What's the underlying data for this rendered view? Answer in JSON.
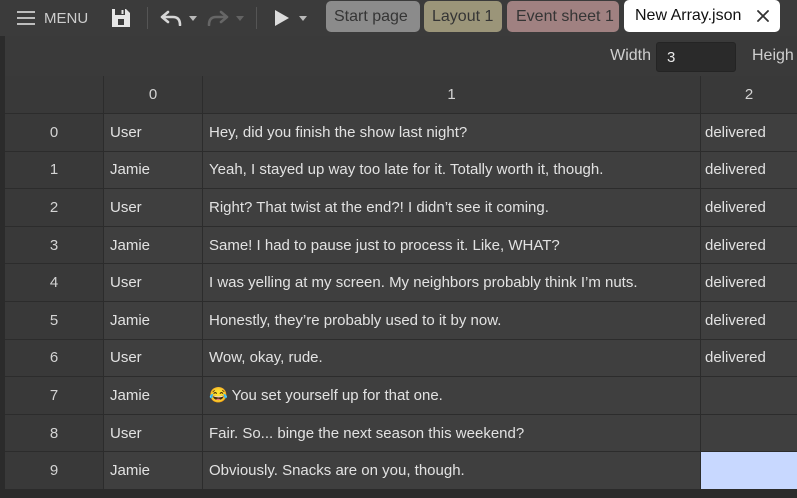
{
  "app": {
    "menu_label": "MENU",
    "icons": {
      "menu": "hamburger-icon",
      "save": "floppy-disk-icon",
      "undo": "undo-icon",
      "redo": "redo-icon",
      "play": "play-icon",
      "dropdown": "chevron-down-icon",
      "close": "close-icon"
    },
    "redo_enabled": false
  },
  "tabs": [
    {
      "label": "Start page",
      "color": "#8b8b8b",
      "active": false
    },
    {
      "label": "Layout 1",
      "color": "#9b9579",
      "active": false
    },
    {
      "label": "Event sheet 1",
      "color": "#a08181",
      "active": false
    },
    {
      "label": "New Array.json",
      "color": "#ffffff",
      "active": true
    }
  ],
  "toolbar": {
    "width_label": "Width",
    "width_value": "3",
    "height_label": "Heigh"
  },
  "array": {
    "column_headers": [
      "0",
      "1",
      "2"
    ],
    "rows": [
      {
        "index": "0",
        "cells": [
          "User",
          "Hey, did you finish the show last night?",
          "delivered"
        ]
      },
      {
        "index": "1",
        "cells": [
          "Jamie",
          "Yeah, I stayed up way too late for it. Totally worth it, though.",
          "delivered"
        ]
      },
      {
        "index": "2",
        "cells": [
          "User",
          "Right? That twist at the end?! I didn’t see it coming.",
          "delivered"
        ]
      },
      {
        "index": "3",
        "cells": [
          "Jamie",
          "Same! I had to pause just to process it. Like, WHAT?",
          "delivered"
        ]
      },
      {
        "index": "4",
        "cells": [
          "User",
          "I was yelling at my screen. My neighbors probably think I’m nuts.",
          "delivered"
        ]
      },
      {
        "index": "5",
        "cells": [
          "Jamie",
          "Honestly, they’re probably used to it by now.",
          "delivered"
        ]
      },
      {
        "index": "6",
        "cells": [
          "User",
          "Wow, okay, rude.",
          "delivered"
        ]
      },
      {
        "index": "7",
        "cells": [
          "Jamie",
          "😂 You set yourself up for that one.",
          ""
        ]
      },
      {
        "index": "8",
        "cells": [
          "User",
          "Fair. So... binge the next season this weekend?",
          ""
        ]
      },
      {
        "index": "9",
        "cells": [
          "Jamie",
          "Obviously. Snacks are on you, though.",
          ""
        ]
      }
    ],
    "selection": {
      "row": 9,
      "column": 2,
      "color": "#c8d8ff"
    }
  }
}
